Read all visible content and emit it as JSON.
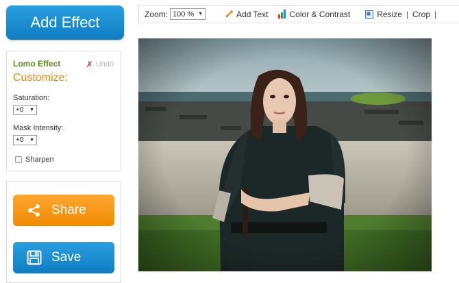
{
  "sidebar": {
    "add_effect_label": "Add Effect",
    "effect_name": "Lomo Effect",
    "undo_label": "Undo",
    "customize_title": "Customize:",
    "saturation_label": "Saturation:",
    "saturation_value": "+0",
    "mask_label": "Mask Intensity:",
    "mask_value": "+0",
    "sharpen_label": "Sharpen",
    "share_label": "Share",
    "save_label": "Save"
  },
  "toolbar": {
    "zoom_label": "Zoom:",
    "zoom_value": "100 %",
    "add_text_label": "Add Text",
    "color_contrast_label": "Color & Contrast",
    "resize_label": "Resize",
    "separator": "|",
    "crop_label": "Crop",
    "more_separator": "|"
  },
  "colors": {
    "primary_blue": "#1489cf",
    "share_orange": "#f59a1c",
    "effect_green": "#5d8a26",
    "customize_orange": "#e08a1c",
    "undo_red": "#d9262b"
  }
}
